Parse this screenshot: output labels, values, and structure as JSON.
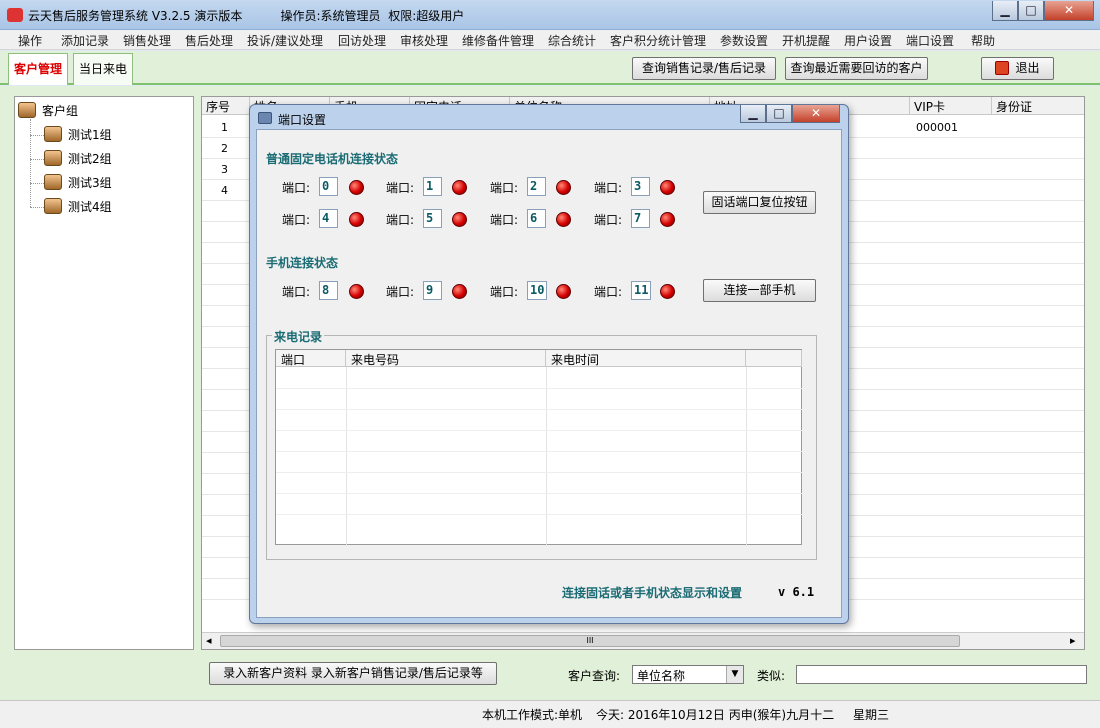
{
  "window": {
    "title": "云天售后服务管理系统 V3.2.5 演示版本          操作员:系统管理员  权限:超级用户",
    "minimize_glyph": "▁",
    "maximize_glyph": "□",
    "close_glyph": "✕"
  },
  "menu": [
    "操作",
    "添加记录",
    "销售处理",
    "售后处理",
    "投诉/建议处理",
    "回访处理",
    "审核处理",
    "维修备件管理",
    "综合统计",
    "客户积分统计管理",
    "参数设置",
    "开机提醒",
    "用户设置",
    "端口设置",
    "帮助"
  ],
  "tabs": {
    "customer": "客户管理",
    "today_calls": "当日来电"
  },
  "toolbar": {
    "query_sales": "查询销售记录/售后记录",
    "query_revisit": "查询最近需要回访的客户",
    "exit": "退出"
  },
  "tree": {
    "root": "客户组",
    "groups": [
      "测试1组",
      "测试2组",
      "测试3组",
      "测试4组"
    ]
  },
  "grid": {
    "columns": [
      "序号",
      "姓名",
      "手机",
      "固定电话",
      "单位名称",
      "地址",
      "VIP卡",
      "身份证"
    ],
    "rows": [
      {
        "index": "1",
        "vip": "000001"
      },
      {
        "index": "2",
        "vip": ""
      },
      {
        "index": "3",
        "vip": ""
      },
      {
        "index": "4",
        "vip": ""
      }
    ],
    "scroll_grip": "III",
    "scroll_left": "◂",
    "scroll_right": "▸"
  },
  "dialog": {
    "title": "端口设置",
    "landline_section": "普通固定电话机连接状态",
    "mobile_section": "手机连接状态",
    "port_label": "端口:",
    "landline_ports": [
      "0",
      "1",
      "2",
      "3",
      "4",
      "5",
      "6",
      "7"
    ],
    "mobile_ports": [
      "8",
      "9",
      "10",
      "11"
    ],
    "reset_button": "固话端口复位按钮",
    "connect_button": "连接一部手机",
    "calls_legend": "来电记录",
    "calls_columns": [
      "端口",
      "来电号码",
      "来电时间"
    ],
    "footer": "连接固话或者手机状态显示和设置",
    "version": "v 6.1",
    "status_color": "#d40000"
  },
  "bottom": {
    "add_button": "录入新客户资料   录入新客户销售记录/售后记录等",
    "query_label": "客户查询:",
    "query_field": "单位名称",
    "similar_label": "类似:"
  },
  "status": {
    "mode": "本机工作模式:单机",
    "date": "今天: 2016年10月12日  丙申(猴年)九月十二",
    "weekday": "星期三"
  }
}
